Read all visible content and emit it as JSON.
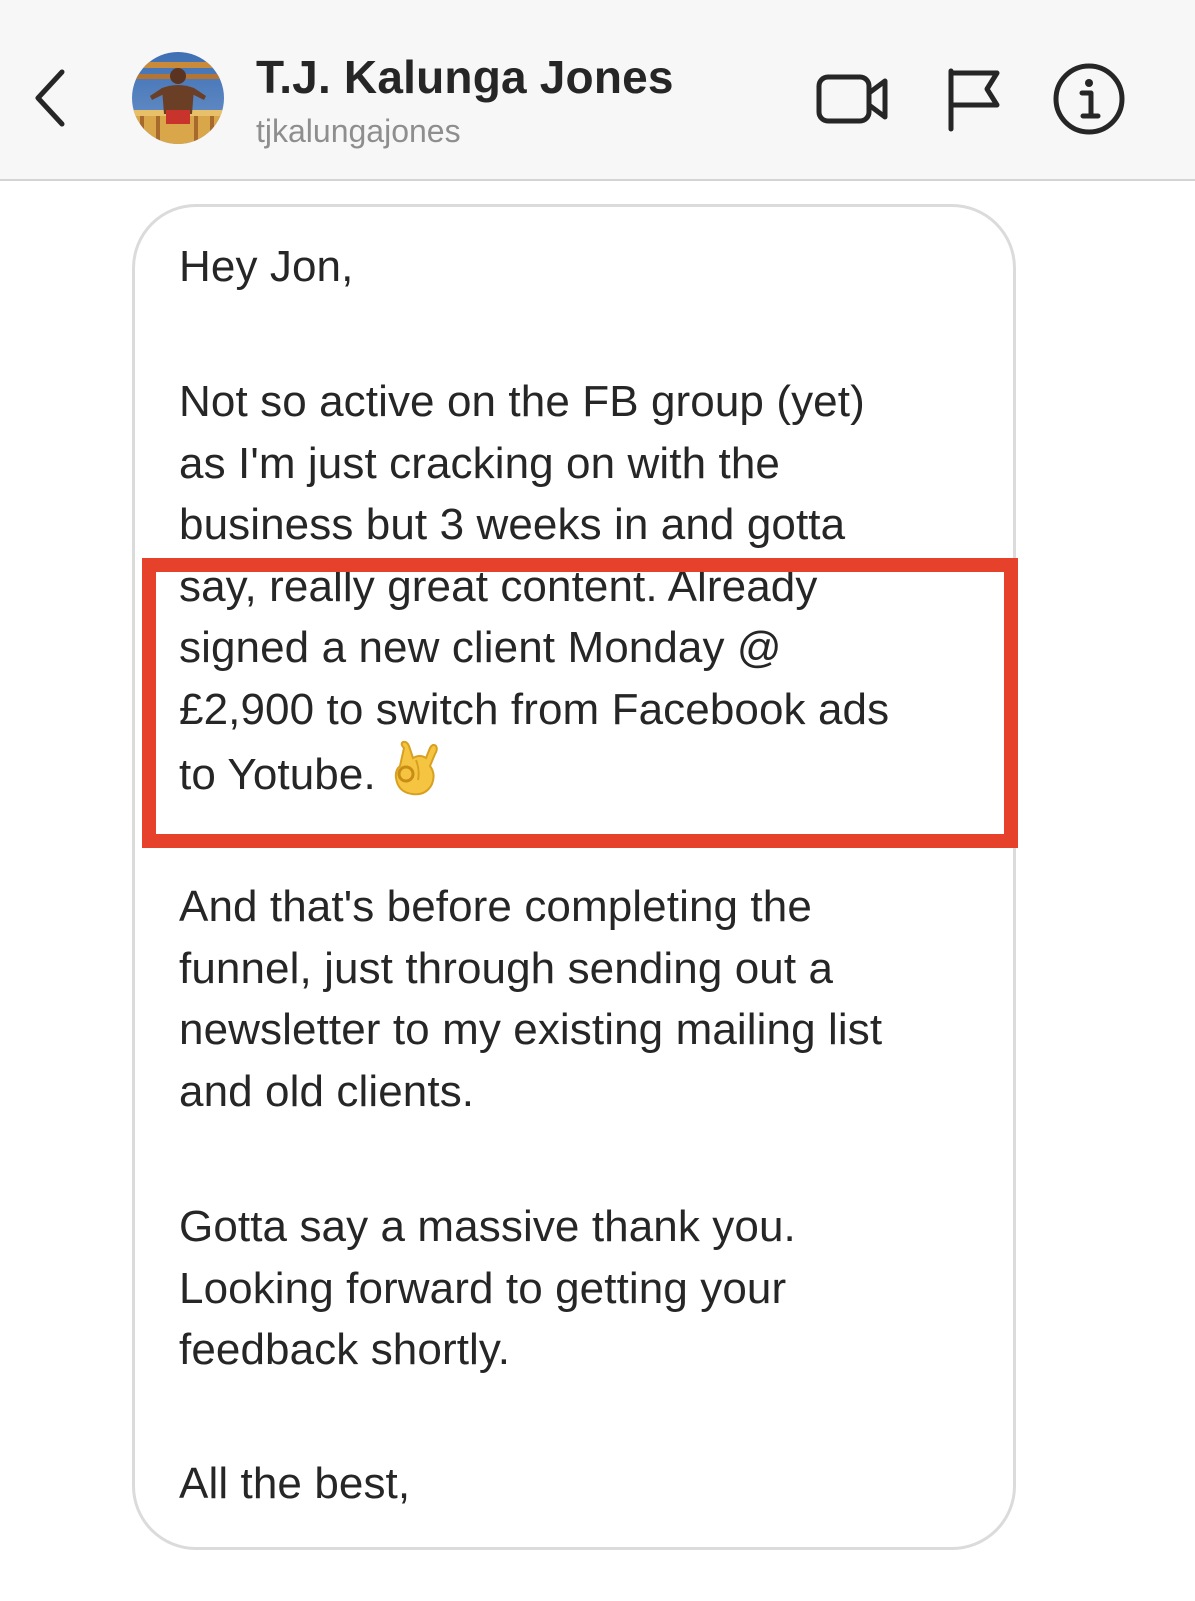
{
  "header": {
    "back_icon": "chevron-left-icon",
    "name": "T.J. Kalunga Jones",
    "handle": "tjkalungajones",
    "icons": [
      "video-camera-icon",
      "flag-icon",
      "info-icon"
    ]
  },
  "message": {
    "greeting": "Hey Jon,",
    "para2": [
      "Not so active on the FB group (yet)",
      "as I'm just cracking on with the",
      "business but 3 weeks in and gotta",
      "say, really great content. Already",
      "signed a new client Monday @",
      "£2,900 to switch from Facebook ads",
      "to Yotube."
    ],
    "para3": [
      "And that's before completing the",
      "funnel, just through sending out a",
      "newsletter to my existing mailing list",
      "and old clients."
    ],
    "para4": [
      "Gotta say a massive thank you.",
      "Looking forward to getting your",
      "feedback shortly."
    ],
    "signoff": "All the best,",
    "emoji": "ok-hand-emoji"
  },
  "colors": {
    "highlight": "#e5412b",
    "header_bg": "#f7f7f7",
    "handle": "#8e8e8e",
    "text": "#262626",
    "bubble_border": "#dbdbdb"
  }
}
